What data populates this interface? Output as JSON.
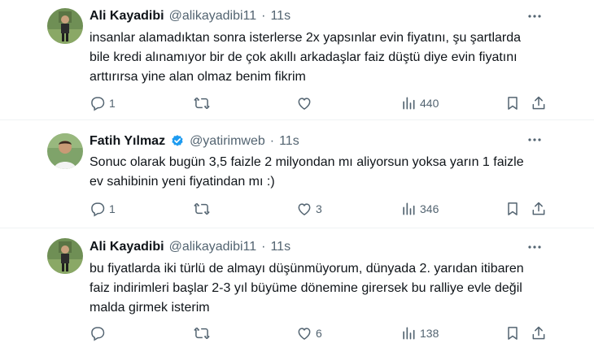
{
  "colors": {
    "text": "#0f1419",
    "muted": "#536471",
    "verified": "#1d9bf0",
    "divider": "#eff3f4"
  },
  "tweets": [
    {
      "author": {
        "name": "Ali Kayadibi",
        "handle": "@alikayadibi11"
      },
      "separator": "·",
      "time": "11s",
      "text_lines": [
        "insanlar alamadıktan sonra isterlerse 2x yapsınlar evin fiyatını, şu şartlarda",
        "bile kredi alınamıyor bir de çok akıllı arkadaşlar faiz düştü diye evin fiyatını",
        "arttırırsa yine alan olmaz benim fikrim"
      ],
      "replies": "1",
      "retweets": "",
      "likes": "",
      "views": "440"
    },
    {
      "author": {
        "name": "Fatih Yılmaz",
        "handle": "@yatirimweb",
        "verified": true
      },
      "separator": "·",
      "time": "11s",
      "text_lines": [
        "Sonuc olarak bugün 3,5 faizle 2 milyondan mı aliyorsun yoksa yarın 1 faizle",
        "ev sahibinin yeni fiyatindan mı :)"
      ],
      "replies": "1",
      "retweets": "",
      "likes": "3",
      "views": "346"
    },
    {
      "author": {
        "name": "Ali Kayadibi",
        "handle": "@alikayadibi11"
      },
      "separator": "·",
      "time": "11s",
      "text_lines": [
        "bu fiyatlarda iki türlü de almayı düşünmüyorum, dünyada 2. yarıdan itibaren",
        "faiz indirimleri başlar 2-3 yıl büyüme dönemine girersek bu ralliye evle değil",
        "malda girmek isterim"
      ],
      "replies": "",
      "retweets": "",
      "likes": "6",
      "views": "138"
    }
  ],
  "icons": [
    "more-icon",
    "reply-icon",
    "retweet-icon",
    "like-icon",
    "views-icon",
    "bookmark-icon",
    "share-icon",
    "verified-icon"
  ]
}
